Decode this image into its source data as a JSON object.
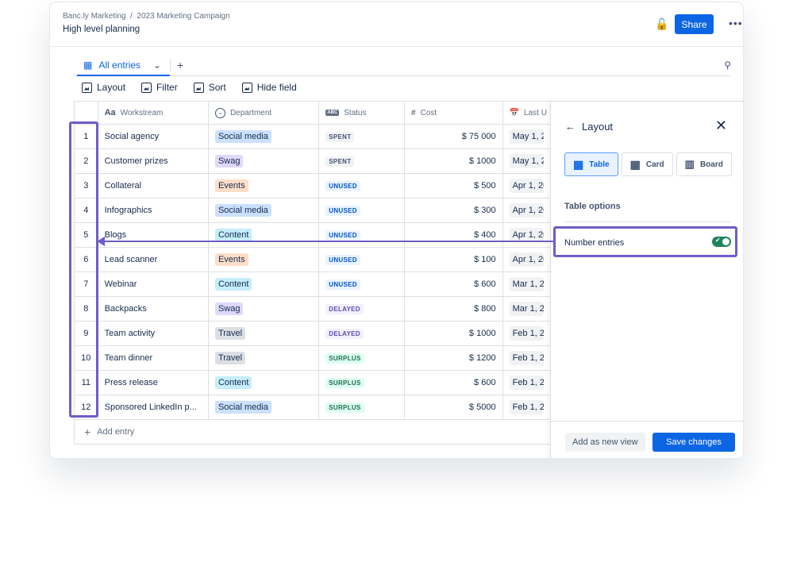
{
  "header": {
    "breadcrumb": [
      "Banc.ly Marketing",
      "2023 Marketing Campaign"
    ],
    "title": "High level planning",
    "share_label": "Share"
  },
  "view_tab": {
    "label": "All entries"
  },
  "toolbar": {
    "layout": "Layout",
    "filter": "Filter",
    "sort": "Sort",
    "hide_field": "Hide field"
  },
  "columns": [
    {
      "label": "Workstream",
      "icon": "Aa"
    },
    {
      "label": "Department",
      "icon": "chevron-circle-icon"
    },
    {
      "label": "Status",
      "icon": "ABC"
    },
    {
      "label": "Cost",
      "icon": "#"
    },
    {
      "label": "Last U",
      "icon": "calendar-icon"
    }
  ],
  "rows": [
    {
      "n": "1",
      "work": "Social agency",
      "dept": "Social media",
      "status": "SPENT",
      "cost": "$ 75 000",
      "date": "May 1, 2"
    },
    {
      "n": "2",
      "work": "Customer prizes",
      "dept": "Swag",
      "status": "SPENT",
      "cost": "$ 1000",
      "date": "May 1, 2"
    },
    {
      "n": "3",
      "work": "Collateral",
      "dept": "Events",
      "status": "UNUSED",
      "cost": "$ 500",
      "date": "Apr 1, 20"
    },
    {
      "n": "4",
      "work": "Infographics",
      "dept": "Social media",
      "status": "UNUSED",
      "cost": "$ 300",
      "date": "Apr 1, 20"
    },
    {
      "n": "5",
      "work": "Blogs",
      "dept": "Content",
      "status": "UNUSED",
      "cost": "$ 400",
      "date": "Apr 1, 20"
    },
    {
      "n": "6",
      "work": "Lead scanner",
      "dept": "Events",
      "status": "UNUSED",
      "cost": "$ 100",
      "date": "Apr 1, 20"
    },
    {
      "n": "7",
      "work": "Webinar",
      "dept": "Content",
      "status": "UNUSED",
      "cost": "$ 600",
      "date": "Mar 1, 20"
    },
    {
      "n": "8",
      "work": "Backpacks",
      "dept": "Swag",
      "status": "DELAYED",
      "cost": "$ 800",
      "date": "Mar 1, 20"
    },
    {
      "n": "9",
      "work": "Team activity",
      "dept": "Travel",
      "status": "DELAYED",
      "cost": "$ 1000",
      "date": "Feb 1, 20"
    },
    {
      "n": "10",
      "work": "Team dinner",
      "dept": "Travel",
      "status": "SURPLUS",
      "cost": "$ 1200",
      "date": "Feb 1, 20"
    },
    {
      "n": "11",
      "work": "Press release",
      "dept": "Content",
      "status": "SURPLUS",
      "cost": "$ 600",
      "date": "Feb 1, 20"
    },
    {
      "n": "12",
      "work": "Sponsored LinkedIn p...",
      "dept": "Social media",
      "status": "SURPLUS",
      "cost": "$ 5000",
      "date": "Feb 1, 20"
    }
  ],
  "add_entry": "Add entry",
  "dept_colors": {
    "Social media": "#cce0ff",
    "Swag": "#dfd8fd",
    "Events": "#fedec8",
    "Content": "#c6edfb",
    "Travel": "#dcdfe4"
  },
  "status_colors": {
    "SPENT": [
      "#f1f2f4",
      "#44546f"
    ],
    "UNUSED": [
      "#e9f2ff",
      "#0055cc"
    ],
    "DELAYED": [
      "#f3f0ff",
      "#5e4db2"
    ],
    "SURPLUS": [
      "#dcfff1",
      "#216e4e"
    ]
  },
  "panel": {
    "title": "Layout",
    "layouts": [
      {
        "label": "Table",
        "selected": true
      },
      {
        "label": "Card",
        "selected": false
      },
      {
        "label": "Board",
        "selected": false
      }
    ],
    "section": "Table options",
    "option_label": "Number entries",
    "option_on": true,
    "add_view": "Add as new view",
    "save": "Save changes"
  },
  "highlight_color": "#6e5dc6"
}
